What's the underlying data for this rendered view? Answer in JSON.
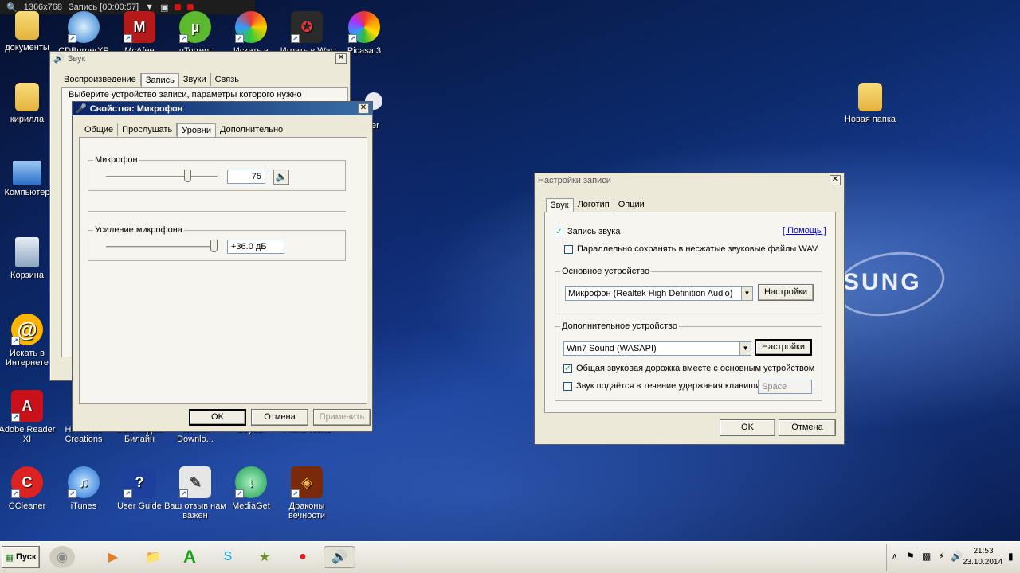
{
  "recorder": {
    "resolution": "1366x768",
    "status": "Запись [00:00:57]"
  },
  "desktop": {
    "icons_col1": [
      "документы",
      "кирилла",
      "Компьютер",
      "Корзина",
      "Искать в Интернете",
      "Adobe Reader XI",
      "CCleaner"
    ],
    "icons_top": [
      "CDBurnerXP",
      "McAfee",
      "uTorrent",
      "Искать в",
      "Играть в War",
      "Picasa 3"
    ],
    "icons_row8": [
      "HP Photo Creations",
      "USB модем Билайн",
      "Winner Downlo...",
      "Stryder",
      "Prime World"
    ],
    "icons_bottom": [
      "iTunes",
      "User Guide",
      "Ваш отзыв нам важен",
      "MediaGet",
      "Драконы вечности"
    ],
    "right_folder": "Новая папка",
    "partial_label": "er",
    "watermark": "SUNG"
  },
  "sound_window": {
    "title": "Звук",
    "tabs": [
      "Воспроизведение",
      "Запись",
      "Звуки",
      "Связь"
    ],
    "selected_tab": "Запись",
    "instruction": "Выберите устройство записи, параметры которого нужно"
  },
  "mic_dialog": {
    "title": "Свойства: Микрофон",
    "tabs": [
      "Общие",
      "Прослушать",
      "Уровни",
      "Дополнительно"
    ],
    "selected_tab": "Уровни",
    "mic_group": "Микрофон",
    "mic_value": "75",
    "mic_level": 0.75,
    "boost_group": "Усиление микрофона",
    "boost_value": "+36.0 дБ",
    "boost_level": 1.0,
    "ok": "OK",
    "cancel": "Отмена",
    "apply": "Применить"
  },
  "rec_settings": {
    "title": "Настройки записи",
    "tabs": [
      "Звук",
      "Логотип",
      "Опции"
    ],
    "selected_tab": "Звук",
    "help": "[ Помощь ]",
    "record_sound": "Запись звука",
    "parallel_wav": "Параллельно сохранять в несжатые звуковые файлы WAV",
    "main_device_group": "Основное устройство",
    "main_device": "Микрофон (Realtek High Definition Audio)",
    "settings_btn": "Настройки",
    "extra_device_group": "Дополнительное устройство",
    "extra_device": "Win7 Sound (WASAPI)",
    "shared_track": "Общая звуковая дорожка вместе с основным устройством",
    "hold_key": "Звук подаётся в течение удержания клавиши",
    "hold_key_value": "Space",
    "ok": "OK",
    "cancel": "Отмена"
  },
  "taskbar": {
    "start": "Пуск",
    "time": "21:53",
    "date": "23.10.2014"
  }
}
